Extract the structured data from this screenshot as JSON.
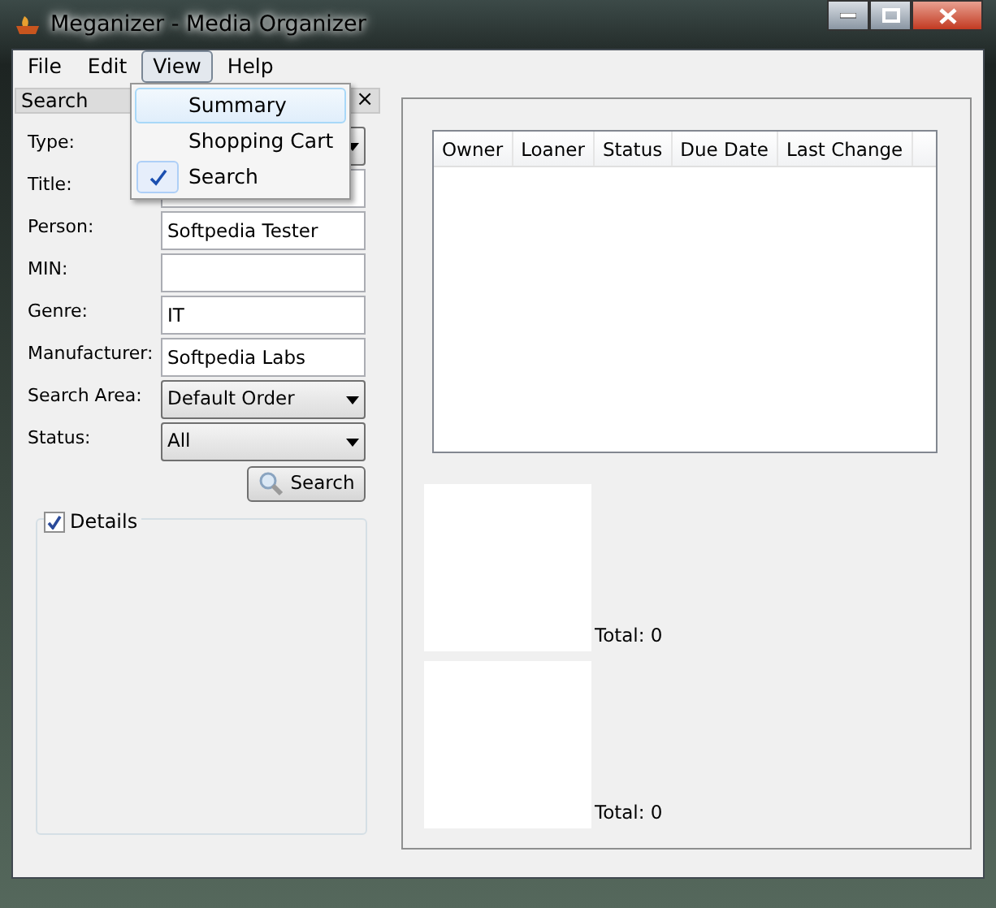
{
  "window": {
    "title": "Meganizer - Media Organizer"
  },
  "menu": [
    {
      "label": "File",
      "selected": false
    },
    {
      "label": "Edit",
      "selected": false
    },
    {
      "label": "View",
      "selected": true
    },
    {
      "label": "Help",
      "selected": false
    }
  ],
  "dropdown": [
    {
      "label": "Summary",
      "checked": false,
      "selected": true
    },
    {
      "label": "Shopping Cart",
      "checked": false,
      "selected": false
    },
    {
      "label": "Search",
      "checked": true,
      "selected": false
    }
  ],
  "search_panel": {
    "title": "Search",
    "close": "×",
    "fields": [
      {
        "label": "Type:",
        "kind": "combo"
      },
      {
        "label": "Title:",
        "kind": "text"
      },
      {
        "label": "Person:",
        "kind": "text",
        "value": "Softpedia Tester"
      },
      {
        "label": "MIN:",
        "kind": "text"
      },
      {
        "label": "Genre:",
        "kind": "text",
        "value": "IT"
      },
      {
        "label": "Manufacturer:",
        "kind": "text",
        "value": "Softpedia Labs"
      },
      {
        "label": "Search Area:",
        "kind": "combo",
        "value": "Default Order"
      },
      {
        "label": "Status:",
        "kind": "combo",
        "value": "All"
      }
    ],
    "search_button": "Search",
    "details": {
      "label": "Details",
      "checked": true
    }
  },
  "table": {
    "columns": [
      "Owner",
      "Loaner",
      "Status",
      "Due Date",
      "Last Change"
    ]
  },
  "summaries": [
    {
      "total": "Total: 0"
    },
    {
      "total": "Total: 0"
    }
  ]
}
